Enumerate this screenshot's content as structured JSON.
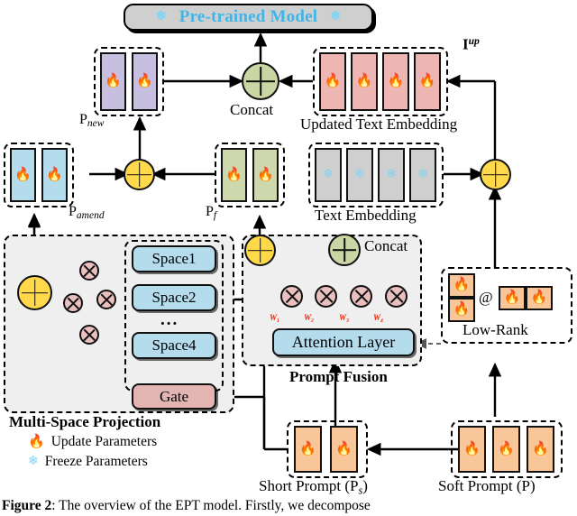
{
  "figure": {
    "caption_label": "Figure 2",
    "caption_text": ": The overview of the EPT model. Firstly, we decompose"
  },
  "pretrained": {
    "label": "Pre-trained Model",
    "icon_left": "snowflake-icon",
    "icon_right": "snowflake-icon",
    "color": "#3fb6ea",
    "bg": "#cfcfcf"
  },
  "concat_top": {
    "label": "Concat",
    "color": "#cad6a4"
  },
  "concat_fusion": {
    "label": "Concat",
    "color": "#cad6a4"
  },
  "blocks": {
    "p_new": {
      "label_main": "P",
      "label_sub": "new",
      "count": 2,
      "color": "#c6bfe0"
    },
    "p_amend": {
      "label_main": "P",
      "label_sub": "amend",
      "count": 2,
      "color": "#b4dcec"
    },
    "p_f": {
      "label_main": "P",
      "label_sub": "f",
      "count": 2,
      "color": "#cdd9ad"
    },
    "updated_text_embedding": {
      "label": "Updated Text Embedding",
      "count": 4,
      "color": "#eeb6b2"
    },
    "text_embedding": {
      "label": "Text Embedding",
      "count": 4,
      "color": "#cfcfcf"
    },
    "short_prompt": {
      "label": "Short Prompt (P",
      "label_sub": "s",
      "label_tail": ")",
      "count": 2,
      "color": "#f7c79a"
    },
    "soft_prompt": {
      "label": "Soft Prompt (P)",
      "count": 3,
      "color": "#f7c79a"
    },
    "low_rank": {
      "label": "Low-Rank",
      "operator": "@",
      "left_count": 2,
      "right_count": 2,
      "color": "#f7c79a"
    }
  },
  "i_up": {
    "main": "I",
    "sup": "up"
  },
  "multi_space": {
    "title": "Multi-Space Projection",
    "spaces": [
      "Space1",
      "Space2",
      "Space4"
    ],
    "ellipsis": "...",
    "gate": "Gate"
  },
  "prompt_fusion": {
    "title": "Prompt Fusion",
    "attention_layer": "Attention Layer",
    "weights": [
      "W₁",
      "W₂",
      "W₃",
      "W₄"
    ]
  },
  "legend": [
    {
      "icon": "flame-icon",
      "label": "Update Parameters"
    },
    {
      "icon": "snowflake-icon",
      "label": "Freeze Parameters"
    }
  ]
}
